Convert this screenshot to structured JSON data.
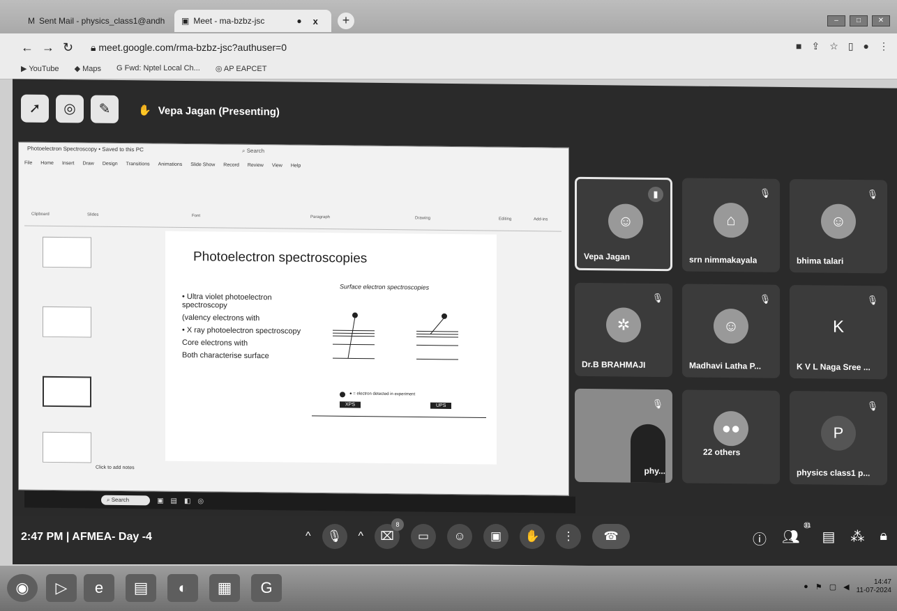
{
  "browser": {
    "tabs": [
      {
        "title": "Sent Mail - physics_class1@andh",
        "close": "x"
      },
      {
        "title": "Meet - ma-bzbz-jsc",
        "close": "x"
      }
    ],
    "new_tab": "+",
    "url": "meet.google.com/rma-bzbz-jsc?authuser=0",
    "bookmarks": [
      "YouTube",
      "Maps",
      "Fwd: Nptel Local Ch...",
      "AP EAPCET"
    ]
  },
  "meet": {
    "presenter_label": "Vepa Jagan (Presenting)",
    "time": "2:47 PM",
    "separator": "|",
    "meeting_name": "AFMEA- Day -4",
    "participant_count": "31",
    "chat_badge": "8",
    "tiles": [
      {
        "name": "Vepa Jagan",
        "kind": "photo",
        "active": true
      },
      {
        "name": "srn nimmakayala",
        "kind": "logo"
      },
      {
        "name": "bhima talari",
        "kind": "photo"
      },
      {
        "name": "Dr.B BRAHMAJI",
        "kind": "logo"
      },
      {
        "name": "Madhavi Latha P...",
        "kind": "photo"
      },
      {
        "name": "K V L Naga Sree ...",
        "kind": "letter",
        "letter": "K"
      },
      {
        "name": "phy...",
        "kind": "video"
      },
      {
        "name": "22 others",
        "kind": "group"
      },
      {
        "name": "physics class1 p...",
        "kind": "letter",
        "letter": "P"
      }
    ]
  },
  "slide_app": {
    "title": "Photoelectron Spectroscopy • Saved to this PC",
    "search": "Search",
    "menu": [
      "File",
      "Home",
      "Insert",
      "Draw",
      "Design",
      "Transitions",
      "Animations",
      "Slide Show",
      "Record",
      "Review",
      "View",
      "Help"
    ],
    "ribbon_groups": [
      "Clipboard",
      "Slides",
      "Font",
      "Paragraph",
      "Drawing",
      "Editing",
      "Add-ins"
    ],
    "notes_placeholder": "Click to add notes",
    "taskbar_search": "Search"
  },
  "slide": {
    "title": "Photoelectron spectroscopies",
    "subtitle": "Surface electron spectroscopies",
    "bullets": [
      "• Ultra violet photoelectron spectroscopy",
      "(valency electrons with",
      "• X ray photoelectron spectroscopy",
      "Core electrons with",
      "Both characterise surface"
    ],
    "tag_left": "XPS",
    "tag_right": "UPS",
    "legend": "● = electron detected in experiment"
  },
  "system": {
    "time": "14:47",
    "date": "11-07-2024"
  }
}
